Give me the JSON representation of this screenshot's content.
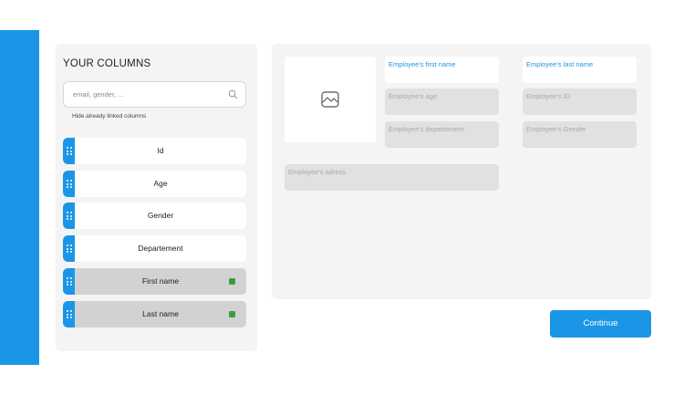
{
  "colors": {
    "accent": "#1b96e6",
    "panel_bg": "#f4f4f4",
    "linked_indicator": "#3e9a3e",
    "linked_row_bg": "#d2d2d2"
  },
  "columns_panel": {
    "title": "YOUR COLUMNS",
    "search": {
      "placeholder": "email, gender, ...",
      "icon": "search-icon"
    },
    "hide_linked_label": "Hide already linked columns",
    "items": [
      {
        "label": "Id",
        "linked": false
      },
      {
        "label": "Age",
        "linked": false
      },
      {
        "label": "Gender",
        "linked": false
      },
      {
        "label": "Departement",
        "linked": false
      },
      {
        "label": "First name",
        "linked": true
      },
      {
        "label": "Last name",
        "linked": true
      }
    ]
  },
  "card": {
    "image_icon": "image-icon",
    "fields": {
      "first_name": "Employee's first name",
      "last_name": "Employee's last name",
      "age": "Employee's age",
      "id": "Employee's ID",
      "departement": "Employee's departement",
      "gender": "Employee's Gender",
      "address": "Employee's adress"
    }
  },
  "actions": {
    "continue_label": "Continue"
  }
}
